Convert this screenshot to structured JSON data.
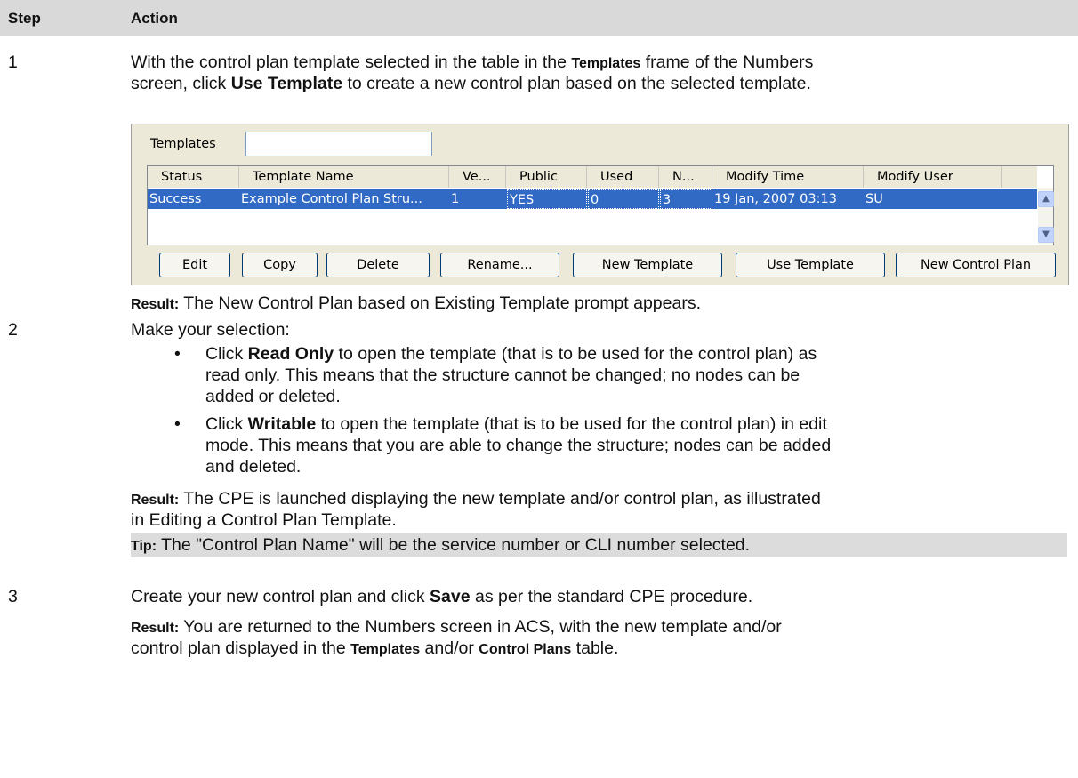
{
  "header": {
    "step": "Step",
    "action": "Action"
  },
  "steps": [
    {
      "number": "1",
      "line1_a": "With the control plan template selected in the table in the ",
      "line1_b": "Templates",
      "line1_c": " frame of the Numbers",
      "line2_a": "screen, click ",
      "line2_b": "Use Template",
      "line2_c": " to create a new control plan based on the selected template.",
      "result_label": "Result:",
      "result_text": " The New Control Plan based on Existing Template prompt appears."
    },
    {
      "number": "2",
      "intro": "Make your selection:",
      "bullets": [
        {
          "prefix": "Click ",
          "bold": "Read Only",
          "lines": [
            "to open the template (that is to be used for the control plan) as",
            "read only. This means that the structure cannot be changed; no nodes can be",
            "added or deleted."
          ]
        },
        {
          "prefix": "Click ",
          "bold": "Writable",
          "lines": [
            "to open the template (that is to be used for the control plan) in edit",
            "mode. This means that you are able to change the structure; nodes can be added",
            "and deleted."
          ]
        }
      ],
      "result_label": "Result:",
      "result_line1": " The CPE is launched displaying the new template and/or control plan, as illustrated",
      "result_line2": "in Editing a Control Plan Template.",
      "tip_label": "Tip:",
      "tip_text": " The \"Control Plan Name\" will be the service number or CLI number selected."
    },
    {
      "number": "3",
      "line_a": "Create your new control plan and click ",
      "line_b": "Save",
      "line_c": " as per the standard CPE procedure.",
      "result_label": "Result:",
      "result_line1": " You are returned to the Numbers screen in ACS, with the new template and/or",
      "result_line2_a": "control plan displayed in the ",
      "result_line2_b": "Templates",
      "result_line2_c": " and/or ",
      "result_line2_d": "Control Plans",
      "result_line2_e": " table."
    }
  ],
  "screenshot": {
    "templates_label": "Templates",
    "templates_input_value": "",
    "columns": [
      "Status",
      "Template Name",
      "Ve...",
      "Public",
      "Used",
      "N...",
      "Modify Time",
      "Modify User"
    ],
    "selected_row": [
      "Success",
      "Example Control Plan Stru...",
      "1",
      "YES",
      "0",
      "3",
      "19 Jan, 2007 03:13",
      "SU"
    ],
    "buttons": [
      "Edit",
      "Copy",
      "Delete",
      "Rename...",
      "New Template",
      "Use Template",
      "New Control Plan"
    ],
    "scroll_up": "▲",
    "scroll_down": "▼"
  },
  "colors": {
    "header_bg": "#d9d9d9",
    "selection": "#316ac5",
    "dialog_bg": "#ece9d8",
    "tip_bg": "#dcdcdc"
  }
}
